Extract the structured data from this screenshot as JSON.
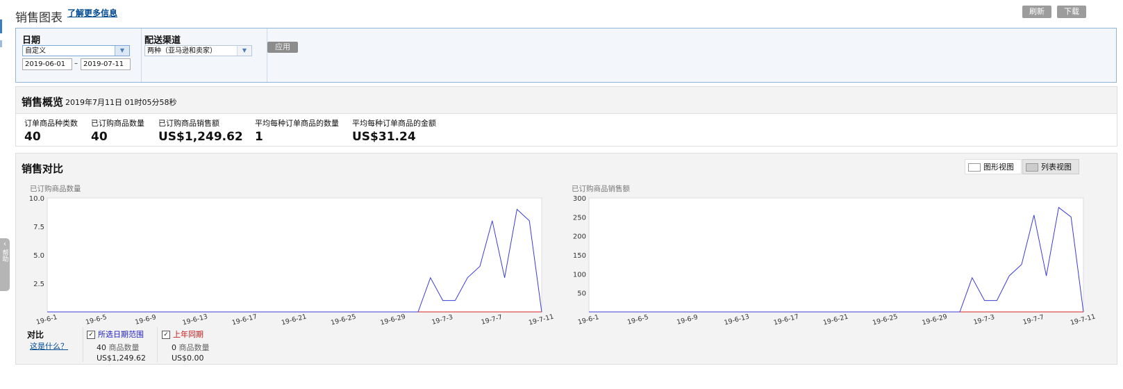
{
  "header": {
    "title": "销售图表",
    "learn_more": "了解更多信息",
    "refresh": "刷新",
    "download": "下载"
  },
  "sidebar_tab": {
    "label": "帮助"
  },
  "filters": {
    "date_label": "日期",
    "date_select": "自定义",
    "start_date": "2019-06-01",
    "dash": "–",
    "end_date": "2019-07-11",
    "channel_label": "配送渠道",
    "channel_select": "两种（亚马逊和卖家）",
    "apply": "应用"
  },
  "overview": {
    "title": "销售概览",
    "timestamp": "2019年7月11日 01时05分58秒",
    "metrics": [
      {
        "label": "订单商品种类数",
        "value": "40"
      },
      {
        "label": "已订购商品数量",
        "value": "40"
      },
      {
        "label": "已订购商品销售额",
        "value": "US$1,249.62"
      },
      {
        "label": "平均每种订单商品的数量",
        "value": "1"
      },
      {
        "label": "平均每种订单商品的金额",
        "value": "US$31.24"
      }
    ]
  },
  "comparison": {
    "title": "销售对比",
    "graph_view": "图形视图",
    "list_view": "列表视图",
    "legend_title": "对比",
    "what_is_this": "这是什么？",
    "series": [
      {
        "name": "所选日期范围",
        "color": "#3b3bd8",
        "qty": "40",
        "qty_unit": "商品数量",
        "amount": "US$1,249.62"
      },
      {
        "name": "上年同期",
        "color": "#d42020",
        "qty": "0",
        "qty_unit": "商品数量",
        "amount": "US$0.00"
      }
    ]
  },
  "chart_data": [
    {
      "type": "line",
      "ylabel": "已订购商品数量",
      "ylim": [
        0,
        10
      ],
      "yticks": [
        "10.0",
        "7.5",
        "5.0",
        "2.5"
      ],
      "ytick_values": [
        10,
        7.5,
        5,
        2.5
      ],
      "x_tick_labels": [
        "19-6-1",
        "19-6-5",
        "19-6-9",
        "19-6-13",
        "19-6-17",
        "19-6-21",
        "19-6-25",
        "19-6-29",
        "19-7-3",
        "19-7-7",
        "19-7-11"
      ],
      "x_count": 41,
      "grid": false,
      "series": [
        {
          "name": "所选日期范围",
          "values": [
            0,
            0,
            0,
            0,
            0,
            0,
            0,
            0,
            0,
            0,
            0,
            0,
            0,
            0,
            0,
            0,
            0,
            0,
            0,
            0,
            0,
            0,
            0,
            0,
            0,
            0,
            0,
            0,
            0,
            0,
            0,
            3,
            1,
            1,
            3,
            4,
            8,
            3,
            9,
            8,
            0
          ]
        },
        {
          "name": "上年同期",
          "values": [
            0,
            0,
            0,
            0,
            0,
            0,
            0,
            0,
            0,
            0,
            0,
            0,
            0,
            0,
            0,
            0,
            0,
            0,
            0,
            0,
            0,
            0,
            0,
            0,
            0,
            0,
            0,
            0,
            0,
            0,
            0,
            0,
            0,
            0,
            0,
            0,
            0,
            0,
            0,
            0,
            0
          ]
        }
      ]
    },
    {
      "type": "line",
      "ylabel": "已订购商品销售额",
      "ylim": [
        0,
        300
      ],
      "yticks": [
        "300",
        "250",
        "200",
        "150",
        "100",
        "50"
      ],
      "ytick_values": [
        300,
        250,
        200,
        150,
        100,
        50
      ],
      "x_tick_labels": [
        "19-6-1",
        "19-6-5",
        "19-6-9",
        "19-6-13",
        "19-6-17",
        "19-6-21",
        "19-6-25",
        "19-6-29",
        "19-7-3",
        "19-7-7",
        "19-7-11"
      ],
      "x_count": 41,
      "grid": false,
      "series": [
        {
          "name": "所选日期范围",
          "values": [
            0,
            0,
            0,
            0,
            0,
            0,
            0,
            0,
            0,
            0,
            0,
            0,
            0,
            0,
            0,
            0,
            0,
            0,
            0,
            0,
            0,
            0,
            0,
            0,
            0,
            0,
            0,
            0,
            0,
            0,
            0,
            90,
            30,
            30,
            95,
            125,
            255,
            95,
            275,
            250,
            0
          ]
        },
        {
          "name": "上年同期",
          "values": [
            0,
            0,
            0,
            0,
            0,
            0,
            0,
            0,
            0,
            0,
            0,
            0,
            0,
            0,
            0,
            0,
            0,
            0,
            0,
            0,
            0,
            0,
            0,
            0,
            0,
            0,
            0,
            0,
            0,
            0,
            0,
            0,
            0,
            0,
            0,
            0,
            0,
            0,
            0,
            0,
            0
          ]
        }
      ]
    }
  ]
}
